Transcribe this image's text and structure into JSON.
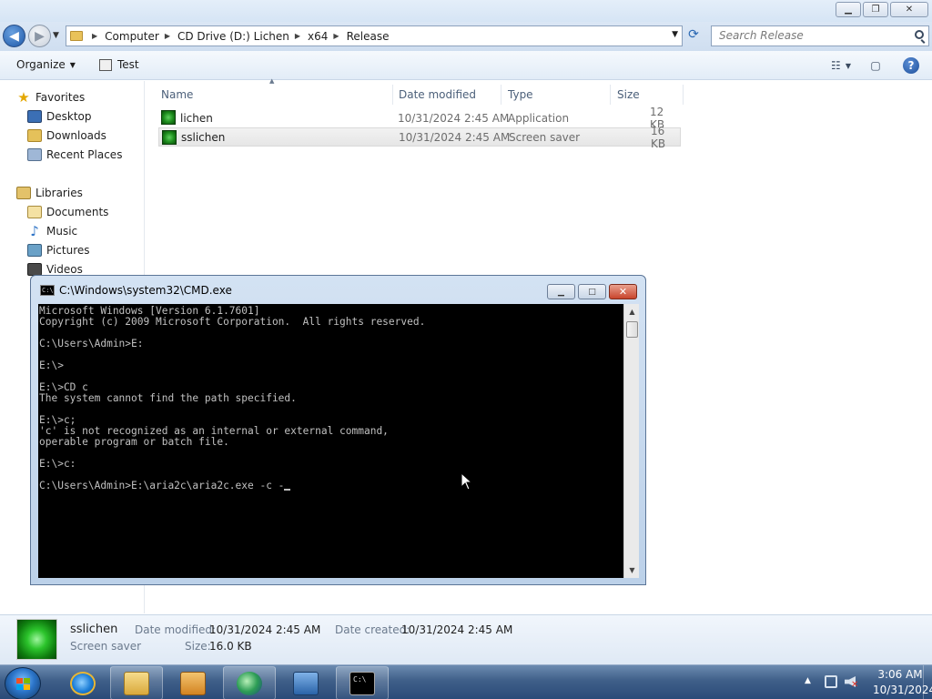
{
  "explorer": {
    "window_buttons": {
      "minimize": "▁",
      "maximize": "❐",
      "close": "✕"
    },
    "breadcrumbs": [
      "Computer",
      "CD Drive (D:) Lichen",
      "x64",
      "Release"
    ],
    "search_placeholder": "Search Release",
    "toolbar": {
      "organize": "Organize",
      "test": "Test"
    },
    "nav": {
      "favorites": "Favorites",
      "favorites_items": [
        "Desktop",
        "Downloads",
        "Recent Places"
      ],
      "libraries": "Libraries",
      "libraries_items": [
        "Documents",
        "Music",
        "Pictures",
        "Videos"
      ]
    },
    "columns": {
      "name": "Name",
      "date": "Date modified",
      "type": "Type",
      "size": "Size"
    },
    "files": [
      {
        "name": "lichen",
        "date": "10/31/2024 2:45 AM",
        "type": "Application",
        "size": "12 KB"
      },
      {
        "name": "sslichen",
        "date": "10/31/2024 2:45 AM",
        "type": "Screen saver",
        "size": "16 KB"
      }
    ],
    "details": {
      "name": "sslichen",
      "kind": "Screen saver",
      "date_modified_label": "Date modified:",
      "date_modified": "10/31/2024 2:45 AM",
      "date_created_label": "Date created:",
      "date_created": "10/31/2024 2:45 AM",
      "size_label": "Size:",
      "size": "16.0 KB"
    }
  },
  "cmd": {
    "title": "C:\\Windows\\system32\\CMD.exe",
    "icon_text": "C:\\",
    "buttons": {
      "minimize": "▁",
      "maximize": "□",
      "close": "✕"
    },
    "lines": [
      "Microsoft Windows [Version 6.1.7601]",
      "Copyright (c) 2009 Microsoft Corporation.  All rights reserved.",
      "",
      "C:\\Users\\Admin>E:",
      "",
      "E:\\>",
      "",
      "E:\\>CD c",
      "The system cannot find the path specified.",
      "",
      "E:\\>c;",
      "'c' is not recognized as an internal or external command,",
      "operable program or batch file.",
      "",
      "E:\\>c:",
      "",
      "C:\\Users\\Admin>E:\\aria2c\\aria2c.exe -c -"
    ]
  },
  "taskbar": {
    "apps": [
      "start-button",
      "internet-explorer",
      "explorer",
      "media-player",
      "network-app",
      "installer-app",
      "command-prompt"
    ],
    "clock_time": "3:06 AM",
    "clock_date": "10/31/2024"
  },
  "colors": {
    "selection": "#e6e6e6",
    "console_bg": "#000000",
    "console_fg": "#c0c0c0",
    "taskbar": "#3f5f89"
  }
}
